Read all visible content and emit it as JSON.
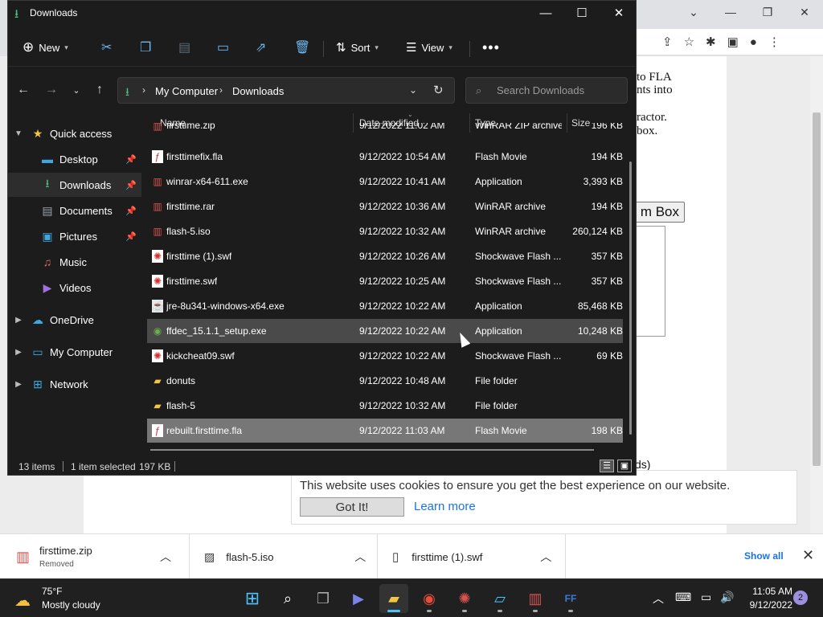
{
  "window": {
    "title": "Downloads"
  },
  "command_bar": {
    "new_label": "New",
    "sort_label": "Sort",
    "view_label": "View"
  },
  "address": {
    "part1": "My Computer",
    "part2": "Downloads"
  },
  "search": {
    "placeholder": "Search Downloads"
  },
  "sidebar": {
    "items": [
      {
        "label": "Quick access",
        "icon": "star-icon"
      },
      {
        "label": "Desktop",
        "icon": "desktop-icon"
      },
      {
        "label": "Downloads",
        "icon": "download-icon"
      },
      {
        "label": "Documents",
        "icon": "documents-icon"
      },
      {
        "label": "Pictures",
        "icon": "pictures-icon"
      },
      {
        "label": "Music",
        "icon": "music-icon"
      },
      {
        "label": "Videos",
        "icon": "videos-icon"
      },
      {
        "label": "OneDrive",
        "icon": "cloud-icon"
      },
      {
        "label": "My Computer",
        "icon": "computer-icon"
      },
      {
        "label": "Network",
        "icon": "network-icon"
      }
    ]
  },
  "columns": {
    "name": "Name",
    "date": "Date modified",
    "type": "Type",
    "size": "Size"
  },
  "files": [
    {
      "name": "firsttime.zip",
      "date": "9/12/2022 11:02 AM",
      "type": "WinRAR ZIP archive",
      "size": "196 KB"
    },
    {
      "name": "firsttimefix.fla",
      "date": "9/12/2022 10:54 AM",
      "type": "Flash Movie",
      "size": "194 KB"
    },
    {
      "name": "winrar-x64-611.exe",
      "date": "9/12/2022 10:41 AM",
      "type": "Application",
      "size": "3,393 KB"
    },
    {
      "name": "firsttime.rar",
      "date": "9/12/2022 10:36 AM",
      "type": "WinRAR archive",
      "size": "194 KB"
    },
    {
      "name": "flash-5.iso",
      "date": "9/12/2022 10:32 AM",
      "type": "WinRAR archive",
      "size": "260,124 KB"
    },
    {
      "name": "firsttime (1).swf",
      "date": "9/12/2022 10:26 AM",
      "type": "Shockwave Flash ...",
      "size": "357 KB"
    },
    {
      "name": "firsttime.swf",
      "date": "9/12/2022 10:25 AM",
      "type": "Shockwave Flash ...",
      "size": "357 KB"
    },
    {
      "name": "jre-8u341-windows-x64.exe",
      "date": "9/12/2022 10:22 AM",
      "type": "Application",
      "size": "85,468 KB"
    },
    {
      "name": "ffdec_15.1.1_setup.exe",
      "date": "9/12/2022 10:22 AM",
      "type": "Application",
      "size": "10,248 KB"
    },
    {
      "name": "kickcheat09.swf",
      "date": "9/12/2022 10:22 AM",
      "type": "Shockwave Flash ...",
      "size": "69 KB"
    },
    {
      "name": "donuts",
      "date": "9/12/2022 10:48 AM",
      "type": "File folder",
      "size": ""
    },
    {
      "name": "flash-5",
      "date": "9/12/2022 10:32 AM",
      "type": "File folder",
      "size": ""
    },
    {
      "name": "rebuilt.firsttime.fla",
      "date": "9/12/2022 11:03 AM",
      "type": "Flash Movie",
      "size": "198 KB"
    }
  ],
  "status": {
    "count": "13 items",
    "selected": "1 item selected",
    "size": "197 KB"
  },
  "webpage": {
    "line1": "to FLA",
    "line2": "nts into",
    "line3": "ractor.",
    "line4": "box.",
    "button": "m Box",
    "downloads_hint": "ds)",
    "cookie_text": "This website uses cookies to ensure you get the best experience on our website.",
    "cookie_button": "Got It!",
    "cookie_link": "Learn more"
  },
  "download_shelf": {
    "items": [
      {
        "name": "firsttime.zip",
        "status": "Removed"
      },
      {
        "name": "flash-5.iso",
        "status": ""
      },
      {
        "name": "firsttime (1).swf",
        "status": ""
      }
    ],
    "show_all": "Show all"
  },
  "taskbar": {
    "weather_temp": "75°F",
    "weather_desc": "Mostly cloudy",
    "time": "11:05 AM",
    "date": "9/12/2022",
    "notifications": "2"
  },
  "colors": {
    "accent": "#4cc2ff",
    "folder": "#f4c542",
    "explorer_bg": "#1c1c1c",
    "link": "#1a73e8"
  }
}
